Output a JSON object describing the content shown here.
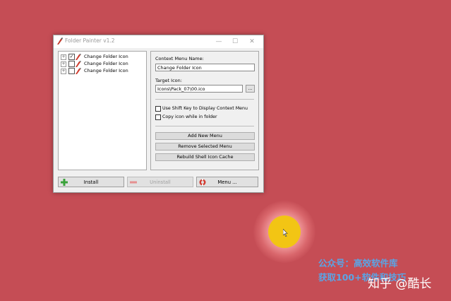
{
  "window": {
    "title": "Folder Painter v1.2",
    "controls": {
      "minimize": "—",
      "maximize": "☐",
      "close": "✕"
    }
  },
  "tree": {
    "items": [
      {
        "expander": "+",
        "checked": true,
        "label": "Change Folder Icon"
      },
      {
        "expander": "+",
        "checked": false,
        "label": "Change Folder Icon"
      },
      {
        "expander": "+",
        "checked": false,
        "label": "Change Folder Icon"
      }
    ]
  },
  "panel": {
    "menu_name_label": "Context Menu Name:",
    "menu_name_value": "Change Folder Icon",
    "target_icon_label": "Target Icon:",
    "target_icon_value": "Icons\\Pack_07\\00.ico",
    "browse_label": "...",
    "shift_key_option": "Use Shift Key to Display Context Menu",
    "copy_icon_option": "Copy icon while in folder",
    "add_menu_label": "Add New Menu",
    "remove_menu_label": "Remove Selected Menu",
    "rebuild_cache_label": "Rebuild Shell Icon Cache"
  },
  "bottom_buttons": {
    "install_label": "Install",
    "uninstall_label": "Uninstall",
    "menu_label": "Menu ..."
  },
  "overlay": {
    "watermark_line1": "公众号：高效软件库",
    "watermark_line2": "获取100+软件和技巧",
    "zhihu_credit": "知乎 @酷长"
  },
  "colors": {
    "background": "#c54d55",
    "cursor_highlight": "#f2c514",
    "watermark": "#5aa5e6"
  }
}
